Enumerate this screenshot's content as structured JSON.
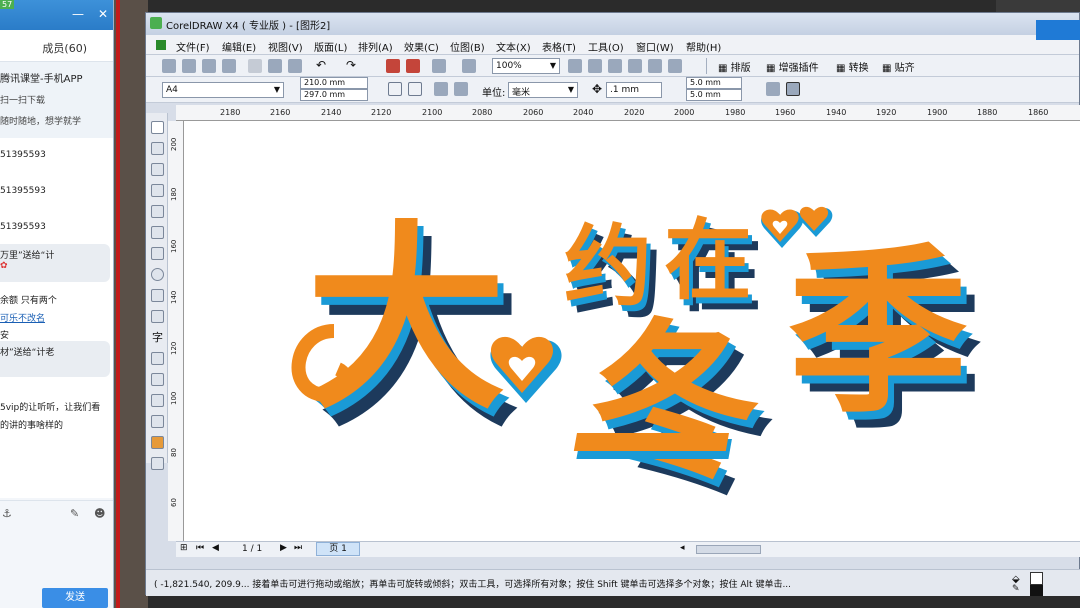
{
  "chat": {
    "badge": "57",
    "tab_members": "成员(60)",
    "notice_title": "腾讯课堂-手机APP",
    "notice_line1": "扫一扫下载",
    "notice_line2": "随时随地，想学就学",
    "messages": [
      {
        "text": "51395593"
      },
      {
        "text": "51395593"
      },
      {
        "text": "51395593"
      },
      {
        "text": "万里”送给“计"
      },
      {
        "text": "余额  只有两个"
      },
      {
        "text": "可乐不改名"
      },
      {
        "text": "安"
      },
      {
        "text": "材”送给“计老"
      },
      {
        "text": "5vip的让听听，让我们看"
      },
      {
        "text": "的讲的事啥样的"
      }
    ],
    "send_label": "发送"
  },
  "corel": {
    "window_title": "CorelDRAW X4 ( 专业版 ) - [图形2]",
    "menu": [
      "文件(F)",
      "编辑(E)",
      "视图(V)",
      "版面(L)",
      "排列(A)",
      "效果(C)",
      "位图(B)",
      "文本(X)",
      "表格(T)",
      "工具(O)",
      "窗口(W)",
      "帮助(H)"
    ],
    "toolbar": {
      "zoom": "100%",
      "plugins": [
        "排版",
        "增强插件",
        "转换",
        "贴齐"
      ]
    },
    "propbar": {
      "page_size": "A4",
      "width": "210.0 mm",
      "height": "297.0 mm",
      "unit_label": "单位:",
      "unit_value": "毫米",
      "nudge": ".1 mm",
      "dup_x": "5.0 mm",
      "dup_y": "5.0 mm"
    },
    "hruler_ticks": [
      "2180",
      "2160",
      "2140",
      "2120",
      "2100",
      "2080",
      "2060",
      "2040",
      "2020",
      "2000",
      "1980",
      "1960",
      "1940",
      "1920",
      "1900",
      "1880",
      "1860"
    ],
    "vruler_ticks": [
      "200",
      "180",
      "160",
      "140",
      "120",
      "100",
      "80",
      "60"
    ],
    "artwork_text": [
      "大",
      "约",
      "在",
      "冬",
      "季"
    ],
    "page_indicator": "1 / 1",
    "page_tab": "页 1",
    "status_text": "( -1,821.540, 209.9...    接着单击可进行拖动或缩放；再单击可旋转或倾斜；双击工具，可选择所有对象；按住 Shift 键单击可选择多个对象；按住 Alt 键单击...",
    "colors": {
      "orange": "#f08a1c",
      "blue": "#1a9ad6",
      "shadow": "#1d3a5c"
    }
  }
}
